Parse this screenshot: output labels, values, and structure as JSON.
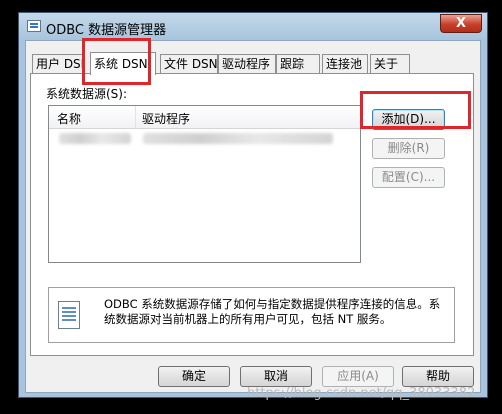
{
  "window": {
    "title": "ODBC 数据源管理器",
    "close_symbol": "X"
  },
  "tabs": [
    {
      "label": "用户 DSN",
      "active": false
    },
    {
      "label": "系统 DSN",
      "active": true
    },
    {
      "label": "文件 DSN",
      "active": false
    },
    {
      "label": "驱动程序",
      "active": false
    },
    {
      "label": "跟踪",
      "active": false
    },
    {
      "label": "连接池",
      "active": false
    },
    {
      "label": "关于",
      "active": false
    }
  ],
  "system_dsn": {
    "section_label": "系统数据源(S):",
    "columns": [
      "名称",
      "驱动程序"
    ],
    "buttons": {
      "add": "添加(D)...",
      "remove": "删除(R)",
      "configure": "配置(C)..."
    },
    "info_text": "ODBC 系统数据源存储了如何与指定数据提供程序连接的信息。系统数据源对当前机器上的所有用户可见，包括 NT 服务。"
  },
  "footer_buttons": {
    "ok": "确定",
    "cancel": "取消",
    "apply": "应用(A)",
    "help": "帮助"
  },
  "watermark": "https://blog.csdn.net/qq_38033382",
  "colors": {
    "highlight": "#e0262b",
    "frame": "#a9c5dd",
    "close": "#c7402a"
  }
}
